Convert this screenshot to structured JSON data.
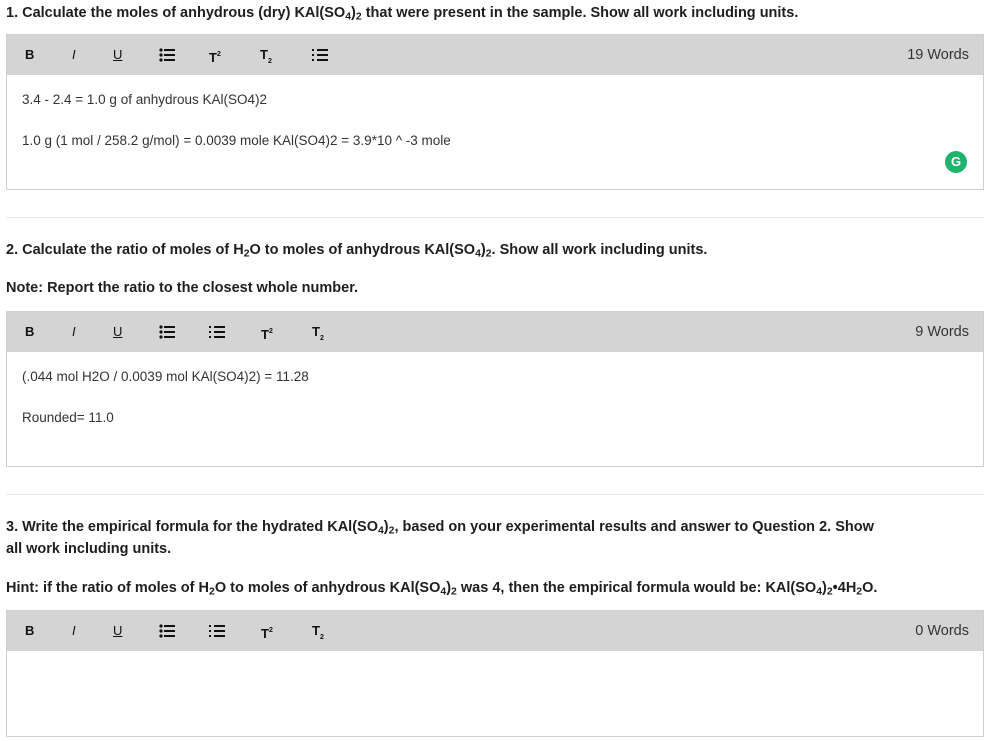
{
  "toolbar": {
    "bold": "B",
    "italic": "I",
    "underline": "U",
    "superscript": "T",
    "subscript": "T"
  },
  "q1": {
    "text_a": "1. Calculate the moles of anhydrous (dry) KAl(SO",
    "sub_a": "4",
    "text_b": ")",
    "sub_b": "2",
    "text_c": " that were present in the sample. Show all work including units.",
    "words": "19 Words",
    "lines": [
      "3.4 - 2.4 = 1.0 g of anhydrous KAl(SO4)2",
      "1.0 g (1 mol / 258.2 g/mol) = 0.0039 mole KAl(SO4)2 = 3.9*10 ^ -3 mole"
    ],
    "grammarly": "G"
  },
  "q2": {
    "text_a": "2. Calculate the ratio of moles of H",
    "sub_a": "2",
    "text_b": "O to moles of anhydrous KAl(SO",
    "sub_b": "4",
    "text_c": ")",
    "sub_c": "2",
    "text_d": ". Show all work including units.",
    "note": "Note: Report the ratio to the closest whole number.",
    "words": "9 Words",
    "lines": [
      "(.044 mol H2O / 0.0039 mol KAl(SO4)2) = 11.28",
      "Rounded= 11.0"
    ]
  },
  "q3": {
    "text_a": "3. Write the empirical formula for the hydrated KAl(SO",
    "sub_a": "4",
    "text_b": ")",
    "sub_b": "2",
    "text_c": ", based on your experimental results and answer to Question 2. Show",
    "text_line2": "all work including units.",
    "hint_a": "Hint: if the ratio of moles of H",
    "hint_sub_a": "2",
    "hint_b": "O to moles of anhydrous KAl(SO",
    "hint_sub_b": "4",
    "hint_c": ")",
    "hint_sub_c": "2",
    "hint_d": " was 4, then the empirical formula would be: KAl(SO",
    "hint_sub_d": "4",
    "hint_e": ")",
    "hint_sub_e": "2",
    "hint_f": "•4H",
    "hint_sub_f": "2",
    "hint_g": "O.",
    "words": "0 Words"
  }
}
